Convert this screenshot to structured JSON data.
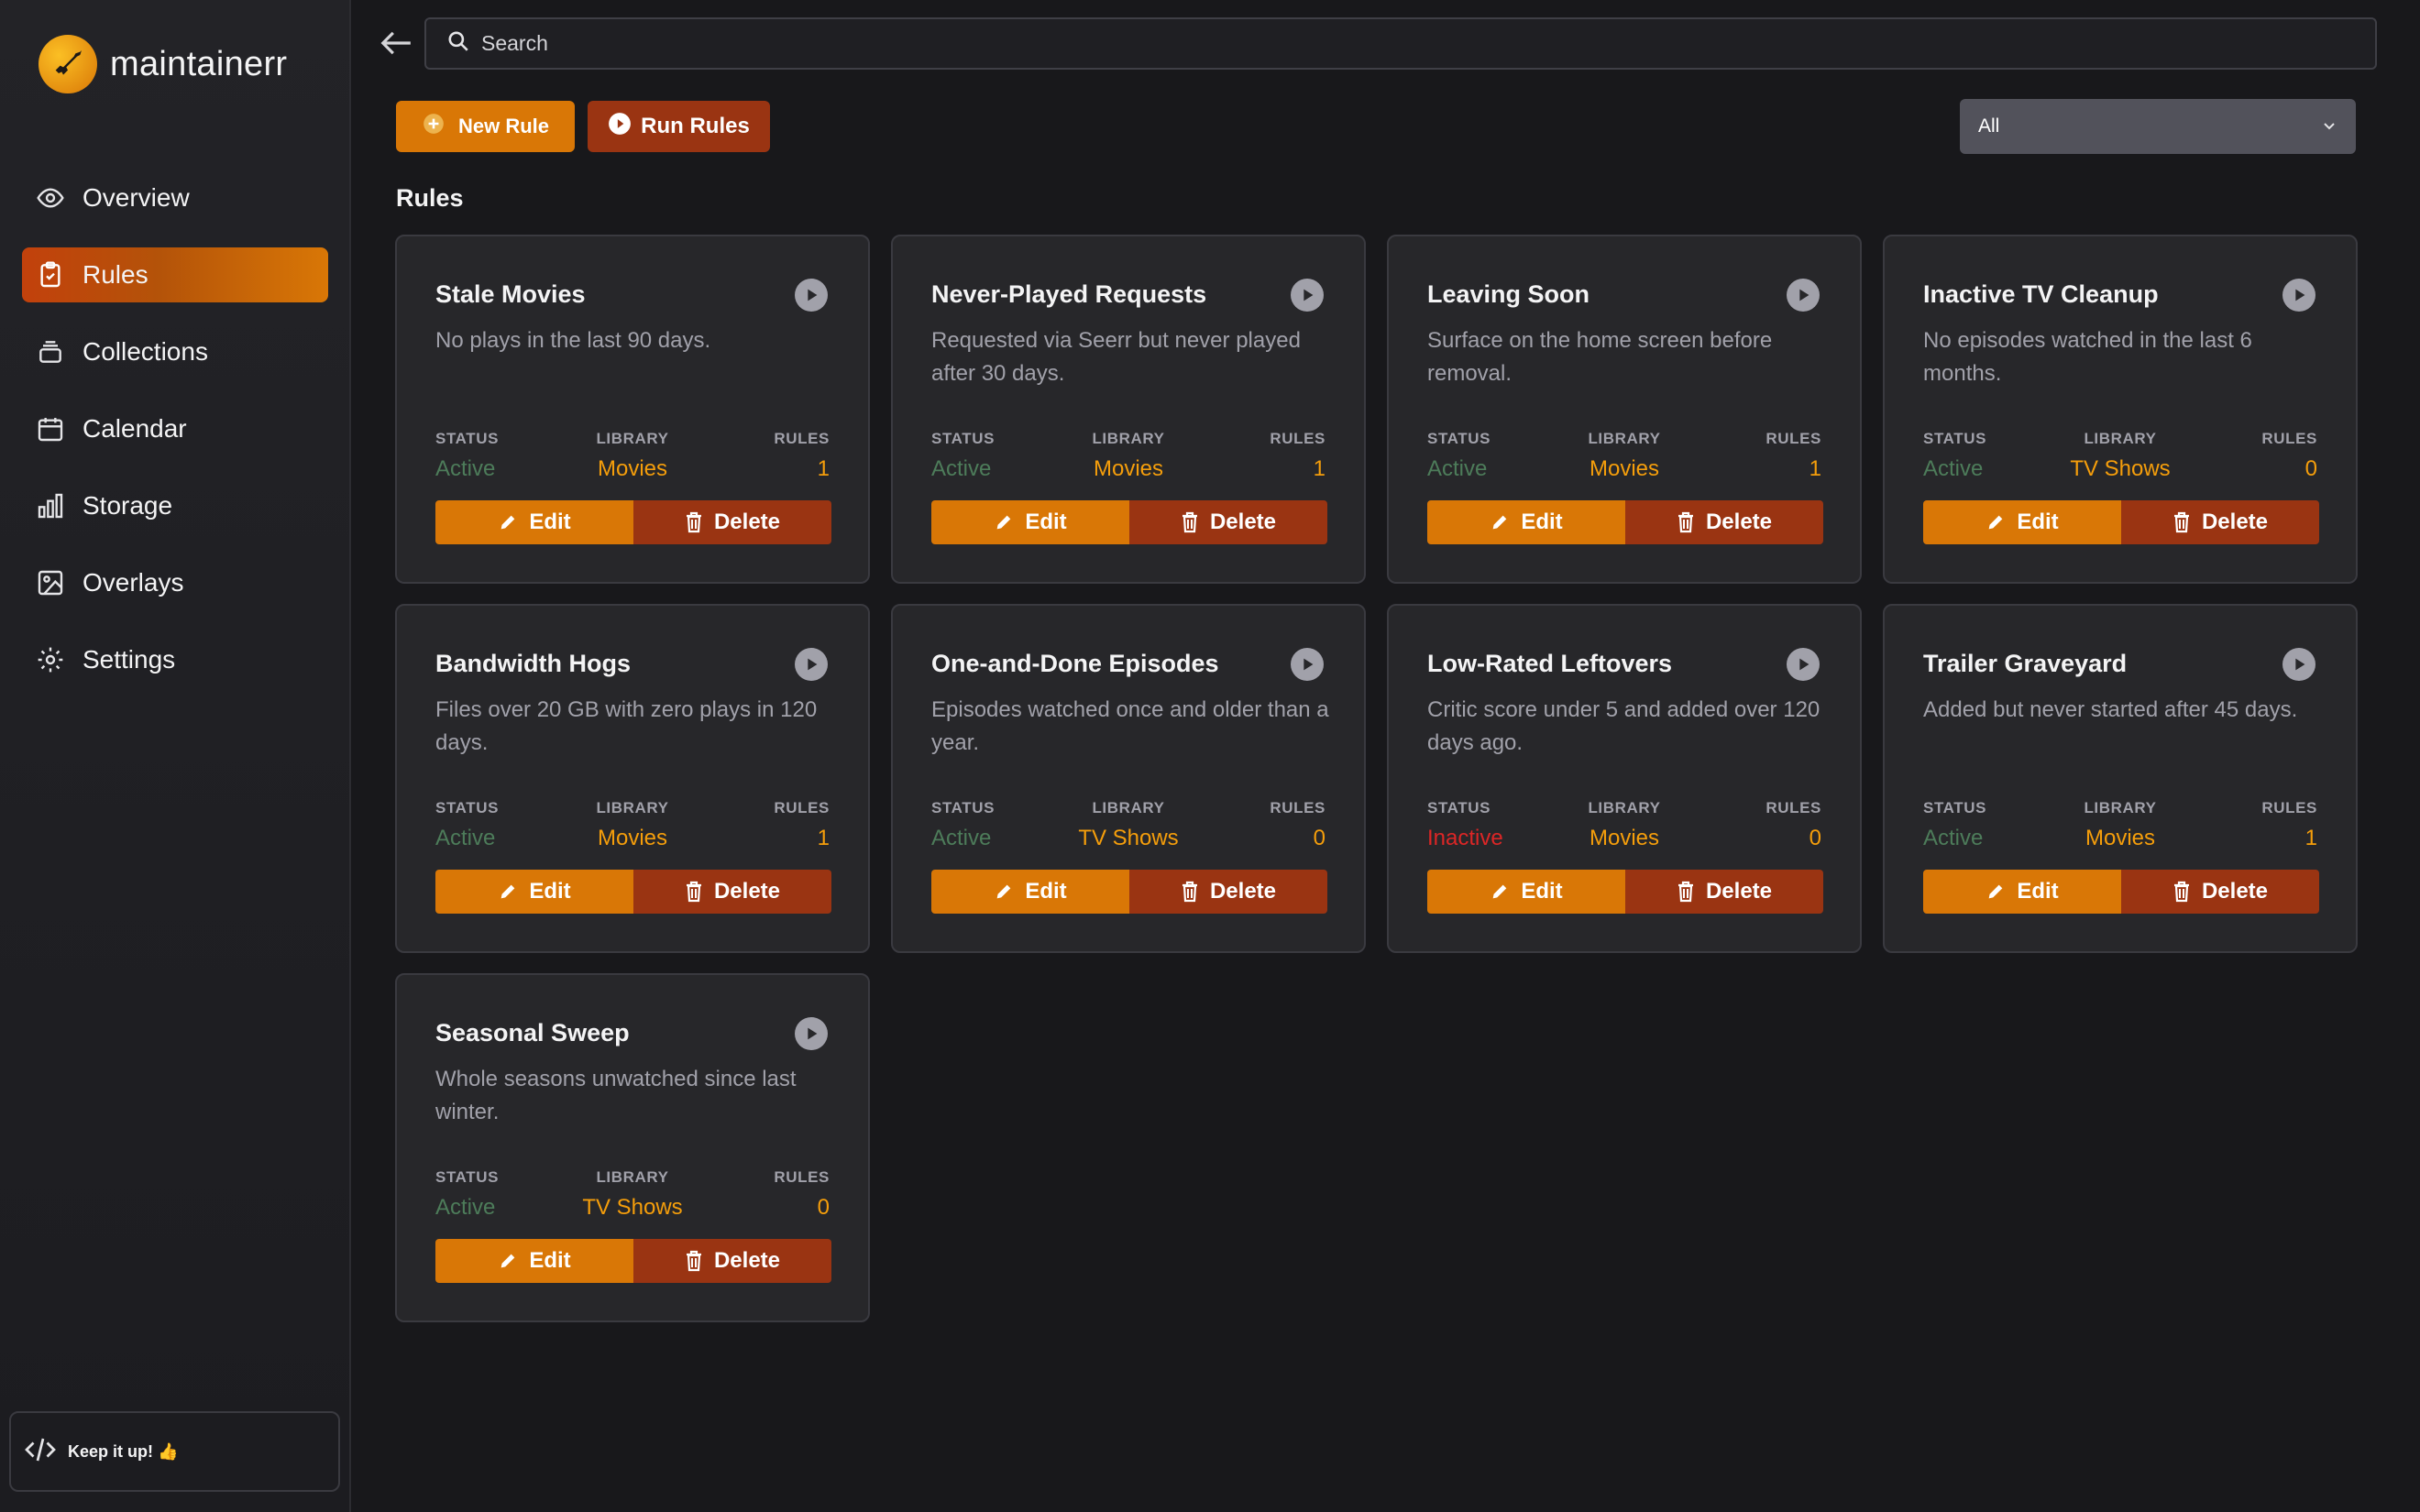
{
  "brand": {
    "name": "maintainerr"
  },
  "sidebar": {
    "items": [
      {
        "label": "Overview",
        "icon": "eye-icon"
      },
      {
        "label": "Rules",
        "icon": "clipboard-icon",
        "active": true
      },
      {
        "label": "Collections",
        "icon": "stack-icon"
      },
      {
        "label": "Calendar",
        "icon": "calendar-icon"
      },
      {
        "label": "Storage",
        "icon": "bar-chart-icon"
      },
      {
        "label": "Overlays",
        "icon": "image-icon"
      },
      {
        "label": "Settings",
        "icon": "gear-icon"
      }
    ],
    "footer": "Keep it up! 👍"
  },
  "search": {
    "placeholder": "Search"
  },
  "toolbar": {
    "new_rule": "New Rule",
    "run_rules": "Run Rules"
  },
  "filter": {
    "selected": "All"
  },
  "section_title": "Rules",
  "labels": {
    "status": "STATUS",
    "library": "LIBRARY",
    "rules": "RULES",
    "edit": "Edit",
    "delete": "Delete"
  },
  "colors": {
    "accent": "#d97706",
    "accent_dark": "#9a3412",
    "active": "#4d7c5a",
    "inactive": "#dc2626",
    "library": "#f59e0b"
  },
  "cards": [
    {
      "title": "Stale Movies",
      "desc": "No plays in the last 90 days.",
      "status": "Active",
      "library": "Movies",
      "rules": "1"
    },
    {
      "title": "Never-Played Requests",
      "desc": "Requested via Seerr but never played after 30 days.",
      "status": "Active",
      "library": "Movies",
      "rules": "1"
    },
    {
      "title": "Leaving Soon",
      "desc": "Surface on the home screen before removal.",
      "status": "Active",
      "library": "Movies",
      "rules": "1"
    },
    {
      "title": "Inactive TV Cleanup",
      "desc": "No episodes watched in the last 6 months.",
      "status": "Active",
      "library": "TV Shows",
      "rules": "0"
    },
    {
      "title": "Bandwidth Hogs",
      "desc": "Files over 20 GB with zero plays in 120 days.",
      "status": "Active",
      "library": "Movies",
      "rules": "1"
    },
    {
      "title": "One-and-Done Episodes",
      "desc": "Episodes watched once and older than a year.",
      "status": "Active",
      "library": "TV Shows",
      "rules": "0"
    },
    {
      "title": "Low-Rated Leftovers",
      "desc": "Critic score under 5 and added over 120 days ago.",
      "status": "Inactive",
      "library": "Movies",
      "rules": "0"
    },
    {
      "title": "Trailer Graveyard",
      "desc": "Added but never started after 45 days.",
      "status": "Active",
      "library": "Movies",
      "rules": "1"
    },
    {
      "title": "Seasonal Sweep",
      "desc": "Whole seasons unwatched since last winter.",
      "status": "Active",
      "library": "TV Shows",
      "rules": "0"
    }
  ]
}
